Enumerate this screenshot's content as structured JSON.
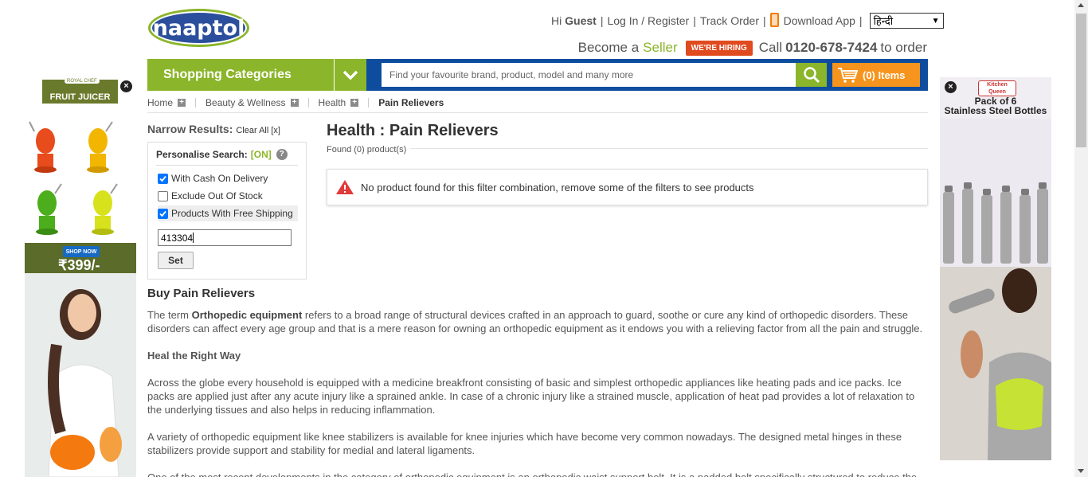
{
  "header": {
    "logo_text": "naaptol",
    "greeting_prefix": "Hi",
    "greeting_user": "Guest",
    "login_label": "Log In / Register",
    "track_label": "Track Order",
    "app_label": "Download App",
    "language_selected": "हिन्दी",
    "become_label": "Become a",
    "seller_label": "Seller",
    "hiring_badge": "WE'RE HIRING",
    "call_label": "Call",
    "phone": "0120-678-7424",
    "order_suffix": "to order"
  },
  "nav": {
    "categories_label": "Shopping Categories",
    "search_placeholder": "Find your favourite brand, product, model and many more",
    "cart_label": "(0) Items"
  },
  "breadcrumb": {
    "items": [
      "Home",
      "Beauty & Wellness",
      "Health"
    ],
    "current": "Pain Relievers"
  },
  "filters": {
    "title": "Narrow Results:",
    "clear_label": "Clear All [x]",
    "personalise_label": "Personalise Search:",
    "personalise_state": "[ON]",
    "options": [
      {
        "label": "With Cash On Delivery",
        "checked": true
      },
      {
        "label": "Exclude Out Of Stock",
        "checked": false
      },
      {
        "label": "Products With Free Shipping",
        "checked": true
      }
    ],
    "pincode_value": "413304",
    "set_label": "Set"
  },
  "main": {
    "title": "Health : Pain Relievers",
    "found_text": "Found (0) product(s)",
    "alert_text": "No product found for this filter combination, remove some of the filters to see products"
  },
  "content": {
    "heading": "Buy Pain Relievers",
    "p1_prefix": "The term ",
    "p1_bold": "Orthopedic equipment",
    "p1_rest": " refers to a broad range of structural devices crafted in an approach to guard, soothe or cure any kind of orthopedic disorders. These disorders can affect every age group and that is a mere reason for owning an orthopedic equipment as it endows you with a relieving factor from all the pain and struggle.",
    "subheading": "Heal the Right Way",
    "p2": "Across the globe every household is equipped with a medicine breakfront consisting of basic and simplest orthopedic appliances like heating pads and ice packs. Ice packs are applied just after any acute injury like a sprained ankle. In case of a chronic injury like a strained muscle, application of heat pad provides a lot of relaxation to the underlying tissues and also helps in reducing inflammation.",
    "p3": "A variety of orthopedic equipment like knee stabilizers is available for knee injuries which have become very common nowadays. The designed metal hinges in these stabilizers provide support and stability for medial and lateral ligaments.",
    "p4": "One of the most recent developments in the category of orthopedic equipment is an orthopedic waist support belt. It is a padded belt specifically structured to reduce the"
  },
  "ads": {
    "left": {
      "brand_top": "ROYAL CHEF",
      "brand": "FRUIT JUICER",
      "shop_now": "SHOP NOW",
      "price": "₹399/-"
    },
    "right": {
      "brand": "Kitchen Queen",
      "headline1": "Pack of 6",
      "headline2": "Stainless Steel Bottles"
    }
  },
  "colors": {
    "brand_green": "#8bb52a",
    "brand_blue": "#0e4d9e",
    "cart_orange": "#f7941d",
    "hiring_red": "#e04a1f"
  }
}
